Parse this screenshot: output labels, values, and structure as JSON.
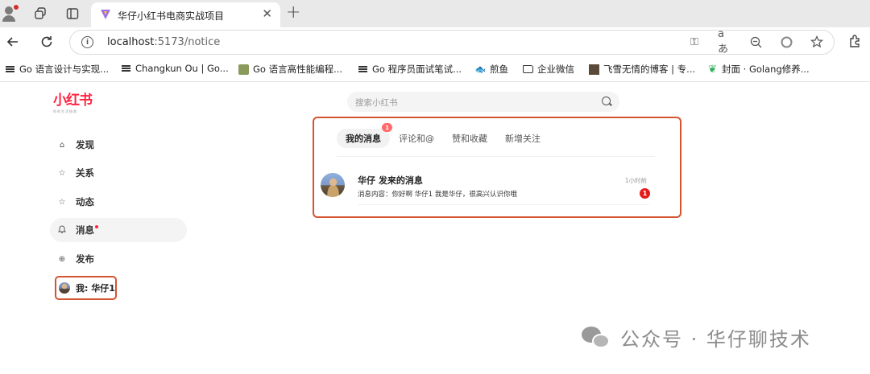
{
  "browser": {
    "tab_title": "华仔小红书电商实战项目",
    "url_host": "localhost",
    "url_rest": ":5173/notice",
    "bookmarks": [
      "Go 语言设计与实现...",
      "Changkun Ou | Go...",
      "Go 语言高性能编程...",
      "Go 程序员面试笔试...",
      "煎鱼",
      "企业微信",
      "飞雪无情的博客 | 专...",
      "封面 · Golang修养..."
    ]
  },
  "logo": {
    "main": "小红书",
    "sub": "你的生活指南"
  },
  "sidebar": {
    "items": [
      {
        "label": "发现",
        "icon": "home-icon"
      },
      {
        "label": "关系",
        "icon": "star-icon"
      },
      {
        "label": "动态",
        "icon": "star-icon"
      },
      {
        "label": "消息",
        "icon": "bell-icon"
      },
      {
        "label": "发布",
        "icon": "plus-circle-icon"
      }
    ],
    "me_label": "我: 华仔1"
  },
  "search": {
    "placeholder": "搜索小红书"
  },
  "notice": {
    "tabs": [
      "我的消息",
      "评论和@",
      "赞和收藏",
      "新增关注"
    ],
    "tab_badge": "1",
    "message": {
      "title": "华仔 发来的消息",
      "time": "1小时前",
      "content": "消息内容：你好啊 华仔1 我是华仔，很高兴认识你哦",
      "badge": "1"
    }
  },
  "watermark": "公众号 · 华仔聊技术",
  "colors": {
    "brand": "#ff2442",
    "highlight_border": "#d35431",
    "badge": "#e41b1b"
  }
}
